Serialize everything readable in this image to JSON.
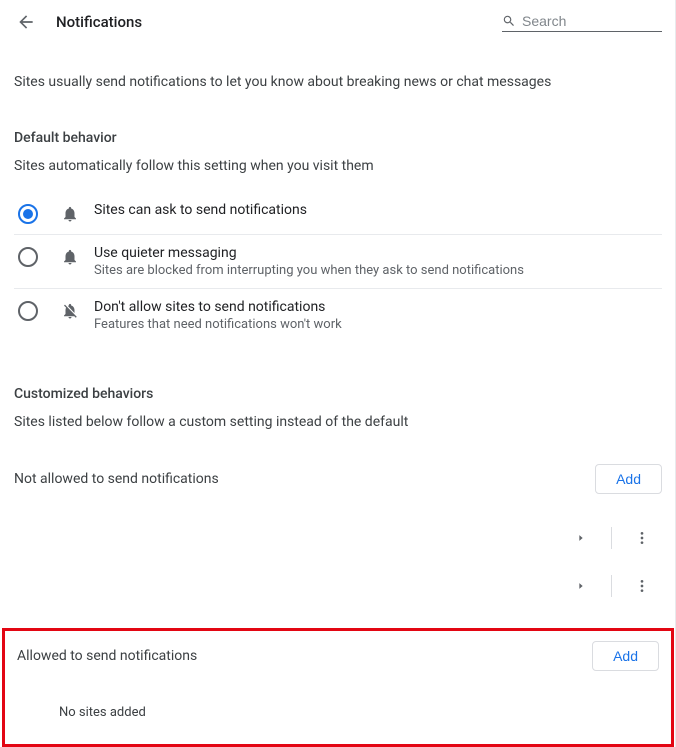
{
  "header": {
    "title": "Notifications",
    "search_placeholder": "Search"
  },
  "intro": "Sites usually send notifications to let you know about breaking news or chat messages",
  "default_behavior": {
    "title": "Default behavior",
    "subtitle": "Sites automatically follow this setting when you visit them",
    "options": [
      {
        "label": "Sites can ask to send notifications",
        "desc": "",
        "selected": true
      },
      {
        "label": "Use quieter messaging",
        "desc": "Sites are blocked from interrupting you when they ask to send notifications",
        "selected": false
      },
      {
        "label": "Don't allow sites to send notifications",
        "desc": "Features that need notifications won't work",
        "selected": false
      }
    ]
  },
  "customized": {
    "title": "Customized behaviors",
    "subtitle": "Sites listed below follow a custom setting instead of the default"
  },
  "not_allowed": {
    "label": "Not allowed to send notifications",
    "add": "Add"
  },
  "allowed": {
    "label": "Allowed to send notifications",
    "add": "Add",
    "empty": "No sites added"
  }
}
